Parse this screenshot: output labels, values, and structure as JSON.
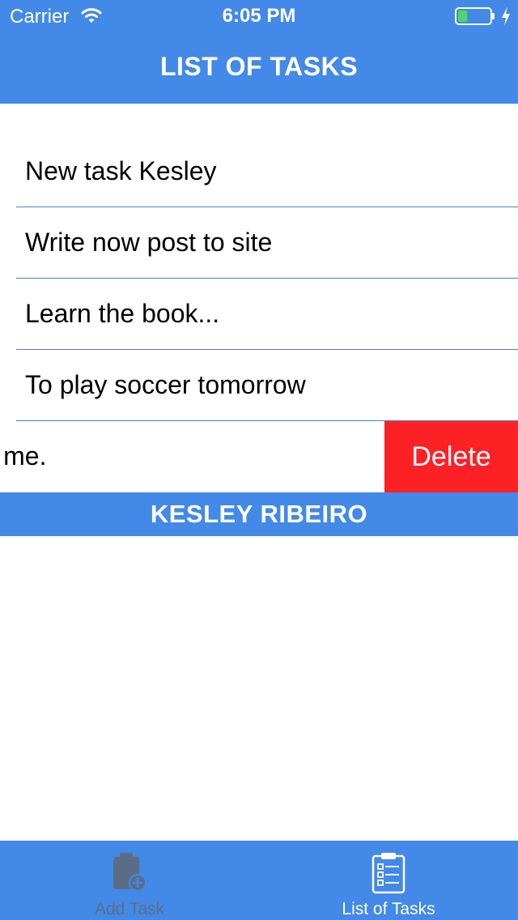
{
  "status_bar": {
    "carrier": "Carrier",
    "time": "6:05 PM",
    "battery_level": 0.3
  },
  "nav": {
    "title": "LIST OF TASKS"
  },
  "tasks": [
    {
      "label": "New task Kesley"
    },
    {
      "label": "Write now post to site"
    },
    {
      "label": "Learn the book..."
    },
    {
      "label": "To play soccer tomorrow"
    },
    {
      "label": "ks for me."
    }
  ],
  "swipe_action": {
    "delete_label": "Delete"
  },
  "footer": {
    "banner": "KESLEY RIBEIRO"
  },
  "tab_bar": {
    "tabs": [
      {
        "label": "Add Task",
        "icon": "clipboard-add-icon",
        "active": false
      },
      {
        "label": "List of Tasks",
        "icon": "clipboard-list-icon",
        "active": true
      }
    ]
  },
  "colors": {
    "brand_blue": "#4289e8",
    "delete_red": "#fc2125",
    "battery_green": "#4cd964",
    "inactive_tab": "#5b6d85"
  }
}
